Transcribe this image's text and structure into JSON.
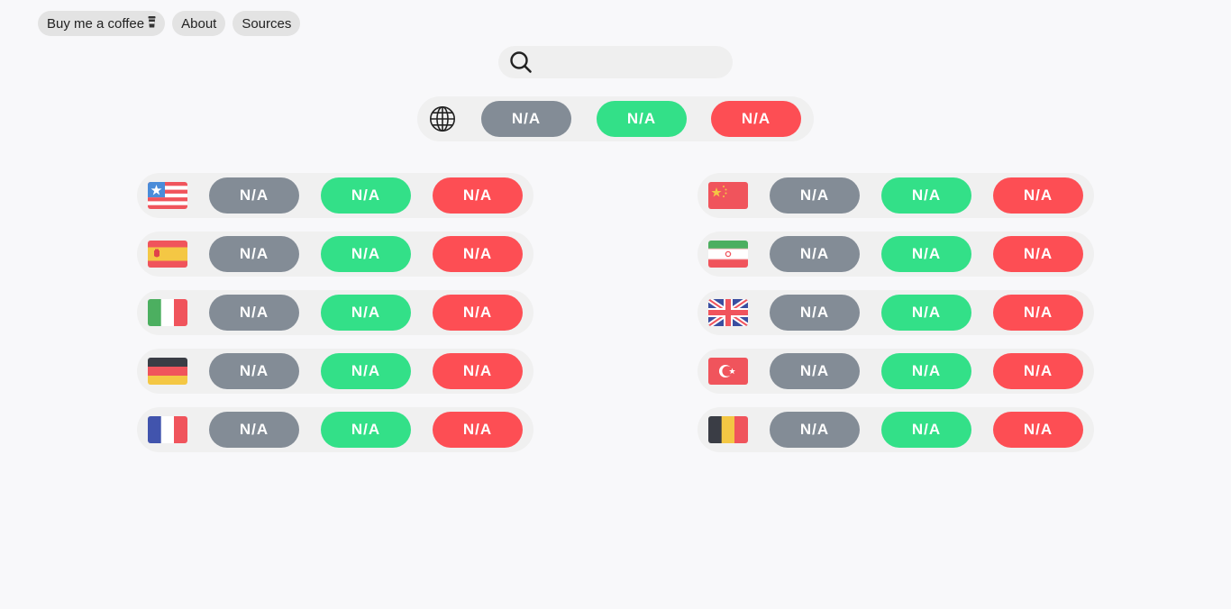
{
  "nav": {
    "coffee_label": "Buy me a coffee",
    "about_label": "About",
    "sources_label": "Sources"
  },
  "search": {
    "placeholder": "",
    "value": ""
  },
  "global": {
    "icon": "globe-icon",
    "values": [
      "N/A",
      "N/A",
      "N/A"
    ]
  },
  "colors": {
    "grey": "#838c96",
    "green": "#33e088",
    "red": "#fd4e54"
  },
  "countries_left": [
    {
      "flag": "usa-flag-icon",
      "values": [
        "N/A",
        "N/A",
        "N/A"
      ]
    },
    {
      "flag": "spain-flag-icon",
      "values": [
        "N/A",
        "N/A",
        "N/A"
      ]
    },
    {
      "flag": "italy-flag-icon",
      "values": [
        "N/A",
        "N/A",
        "N/A"
      ]
    },
    {
      "flag": "germany-flag-icon",
      "values": [
        "N/A",
        "N/A",
        "N/A"
      ]
    },
    {
      "flag": "france-flag-icon",
      "values": [
        "N/A",
        "N/A",
        "N/A"
      ]
    }
  ],
  "countries_right": [
    {
      "flag": "china-flag-icon",
      "values": [
        "N/A",
        "N/A",
        "N/A"
      ]
    },
    {
      "flag": "iran-flag-icon",
      "values": [
        "N/A",
        "N/A",
        "N/A"
      ]
    },
    {
      "flag": "uk-flag-icon",
      "values": [
        "N/A",
        "N/A",
        "N/A"
      ]
    },
    {
      "flag": "turkey-flag-icon",
      "values": [
        "N/A",
        "N/A",
        "N/A"
      ]
    },
    {
      "flag": "belgium-flag-icon",
      "values": [
        "N/A",
        "N/A",
        "N/A"
      ]
    }
  ]
}
